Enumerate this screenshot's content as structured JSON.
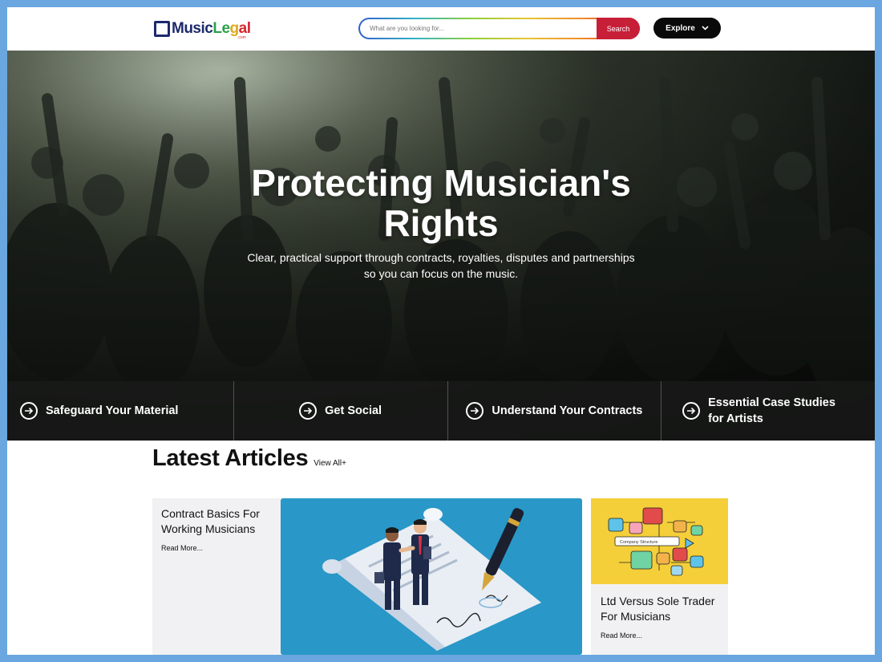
{
  "header": {
    "logo": {
      "part1": "Music",
      "part2": "Le",
      "part3": "g",
      "part4": "al",
      "suffix": ".com"
    },
    "search": {
      "placeholder": "What are you looking for...",
      "button": "Search"
    },
    "explore": {
      "label": "Explore"
    }
  },
  "hero": {
    "title_line1": "Protecting Musician's",
    "title_line2": "Rights",
    "subtitle_line1": "Clear, practical support through contracts, royalties, disputes and partnerships",
    "subtitle_line2": "so you can focus on the music."
  },
  "quick_links": [
    {
      "label": "Safeguard Your Material",
      "icon": "arrow-right-circle-icon"
    },
    {
      "label": "Get Social",
      "icon": "arrow-right-circle-icon"
    },
    {
      "label": "Understand Your Contracts",
      "icon": "arrow-right-circle-icon"
    },
    {
      "label": "Essential Case Studies for Artists",
      "icon": "arrow-right-circle-icon"
    }
  ],
  "articles": {
    "heading": "Latest Articles",
    "view_all": "View All+",
    "items": [
      {
        "title": "Contract Basics For Working Musicians",
        "read_more": "Read More..."
      },
      {
        "title": "Ltd Versus Sole Trader For Musicians",
        "read_more": "Read More...",
        "illustration_label": "Company Structure"
      }
    ]
  },
  "colors": {
    "accent_red": "#c81f39",
    "brand_navy": "#1c2a6b",
    "card_blue": "#2997c7",
    "card_yellow": "#f5cf3a",
    "frame": "#6aa6e0"
  }
}
